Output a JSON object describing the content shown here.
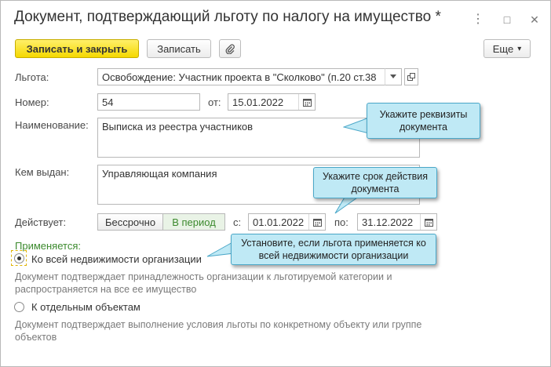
{
  "window": {
    "title": "Документ, подтверждающий льготу по налогу на имущество *",
    "controls": {
      "menu": "⋮",
      "minimize": "□",
      "close": "✕"
    }
  },
  "toolbar": {
    "save_close_label": "Записать и закрыть",
    "save_label": "Записать",
    "more_label": "Еще",
    "more_arrow": "▾"
  },
  "form": {
    "benefit": {
      "label": "Льгота:",
      "value": "Освобождение: Участник проекта в \"Сколково\" (п.20 ст.38"
    },
    "number": {
      "label": "Номер:",
      "value": "54",
      "date_label": "от:",
      "date_value": "15.01.2022"
    },
    "name": {
      "label": "Наименование:",
      "value": "Выписка из реестра участников"
    },
    "issued_by": {
      "label": "Кем выдан:",
      "value": "Управляющая компания"
    },
    "valid": {
      "label": "Действует:",
      "unlimited_label": "Бессрочно",
      "period_label": "В период",
      "from_label": "с:",
      "from_value": "01.01.2022",
      "to_label": "по:",
      "to_value": "31.12.2022"
    },
    "applies": {
      "label": "Применяется:",
      "option_all": "Ко всей недвижимости организации",
      "option_all_desc": "Документ подтверждает принадлежность организации к льготируемой категории и распространяется на все ее имущество",
      "option_separate": "К отдельным объектам",
      "option_separate_desc": "Документ подтверждает выполнение условия льготы по конкретному объекту или группе объектов",
      "selected": "all"
    }
  },
  "callouts": {
    "details": "Укажите реквизиты документа",
    "period": "Укажите срок действия документа",
    "all_property": "Установите, если льгота применяется ко всей недвижимости организации"
  },
  "colors": {
    "primary_button": "#f5d800",
    "callout_bg": "#bfe9f5",
    "callout_border": "#4aa7c8",
    "applies_label": "#3c8a2e"
  }
}
